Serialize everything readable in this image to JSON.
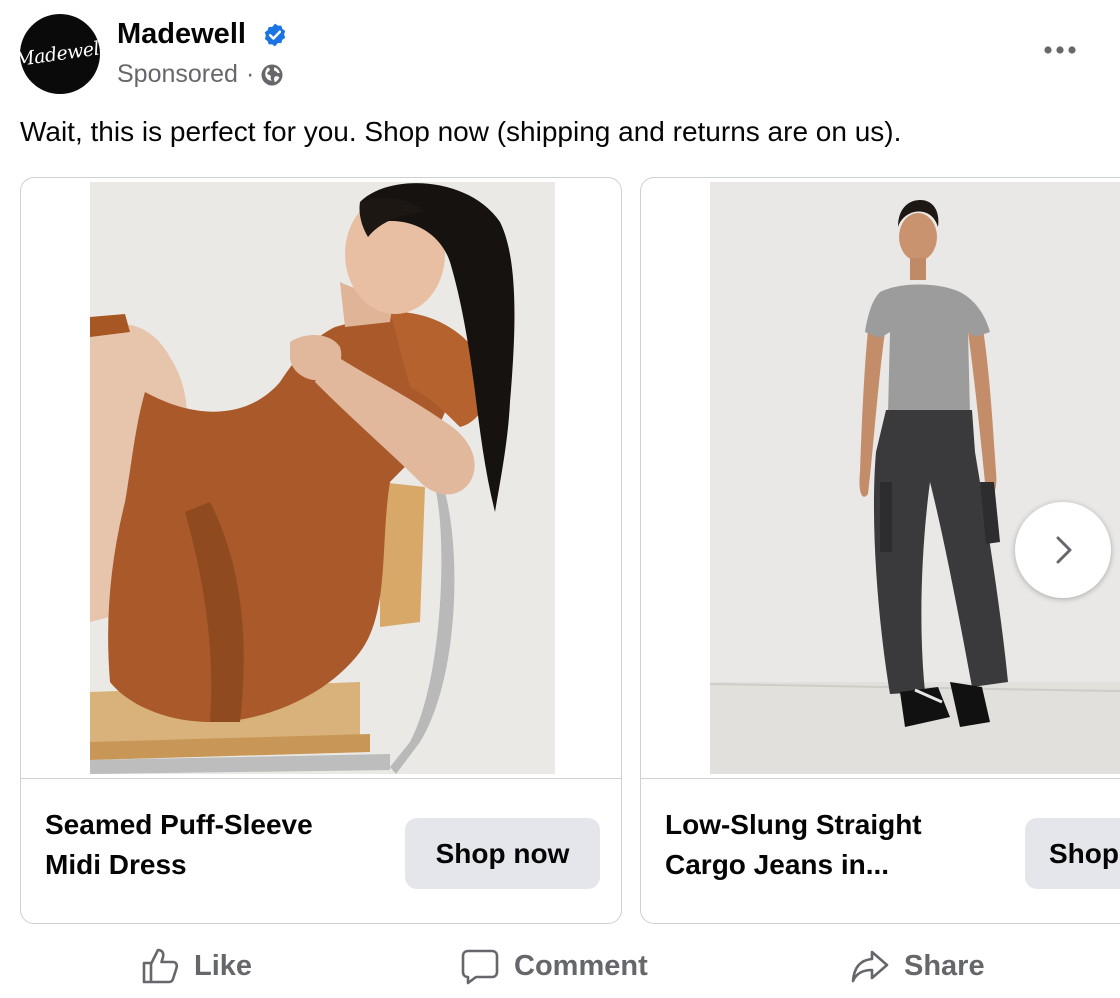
{
  "post": {
    "page_name": "Madewell",
    "logo_text": "Madewell",
    "sponsored_label": "Sponsored",
    "separator": "·",
    "caption": "Wait, this is perfect for you. Shop now (shipping and returns are on us)."
  },
  "carousel": {
    "cards": [
      {
        "title": "Seamed Puff-Sleeve Midi Dress",
        "cta": "Shop now"
      },
      {
        "title": "Low-Slung Straight Cargo Jeans in...",
        "cta": "Shop now"
      }
    ]
  },
  "actions": {
    "like": "Like",
    "comment": "Comment",
    "share": "Share"
  },
  "colors": {
    "verified": "#1b74e4",
    "secondary_text": "#65676b",
    "button_bg": "#e4e6eb",
    "border": "#ced0d4"
  },
  "icons": [
    "verified-badge-icon",
    "globe-icon",
    "more-options-icon",
    "chevron-right-icon",
    "like-icon",
    "comment-icon",
    "share-icon"
  ]
}
